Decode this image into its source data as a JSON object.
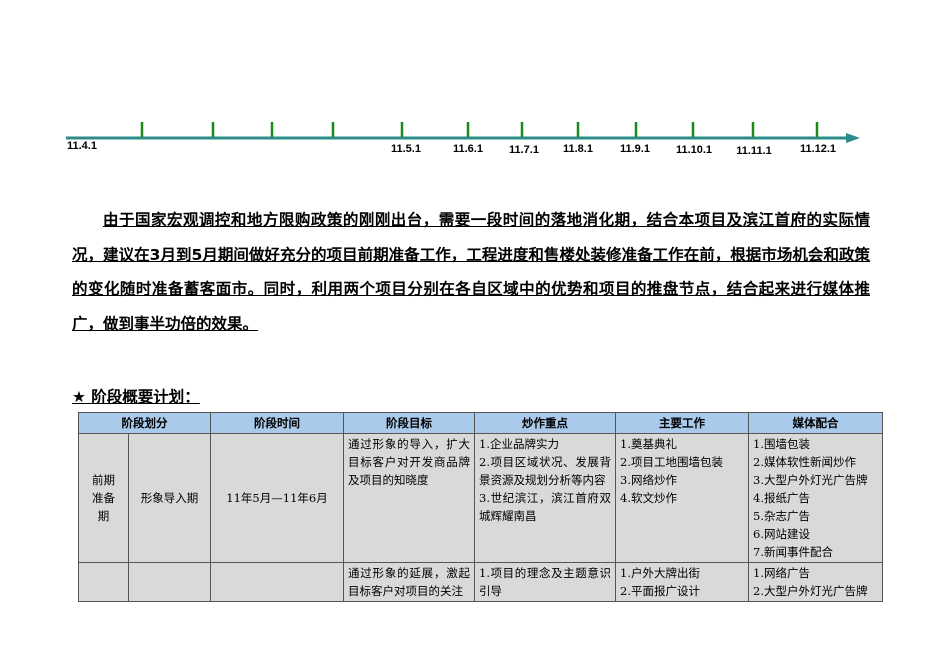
{
  "timeline": {
    "labels": [
      {
        "text": "11.4.1"
      },
      {
        "text": "11.5.1"
      },
      {
        "text": "11.6.1"
      },
      {
        "text": "11.7.1"
      },
      {
        "text": "11.8.1"
      },
      {
        "text": "11.9.1"
      },
      {
        "text": "11.10.1"
      },
      {
        "text": "11.11.1"
      },
      {
        "text": "11.12.1"
      }
    ],
    "color": "#2e8b8b",
    "tick_color": "#1a8a1a"
  },
  "paragraph": "由于国家宏观调控和地方限购政策的刚刚出台，需要一段时间的落地消化期，结合本项目及滨江首府的实际情况，建议在3月到5月期间做好充分的项目前期准备工作，工程进度和售楼处装修准备工作在前，根据市场机会和政策的变化随时准备蓄客面市。同时，利用两个项目分别在各自区域中的优势和项目的推盘节点，结合起来进行媒体推广，做到事半功倍的效果。",
  "plan_title": "★ 阶段概要计划：",
  "table": {
    "headers": [
      "阶段划分",
      "阶段时间",
      "阶段目标",
      "炒作重点",
      "主要工作",
      "媒体配合"
    ],
    "rows": [
      {
        "phase": "前期准备期",
        "subphase": "形象导入期",
        "time": "11年5月—11年6月",
        "goal": "通过形象的导入，扩大目标客户对开发商品牌及项目的知晓度",
        "focus": [
          "1.企业品牌实力",
          "2.项目区域状况、发展背景资源及规划分析等内容",
          "3.世纪滨江，滨江首府双城辉耀南昌"
        ],
        "work": [
          "1.奠基典礼",
          "2.项目工地围墙包装",
          "3.网络炒作",
          "4.软文炒作"
        ],
        "media": [
          "1.围墙包装",
          "2.媒体软性新闻炒作",
          "3.大型户外灯光广告牌",
          "4.报纸广告",
          "5.杂志广告",
          "6.网站建设",
          "7.新闻事件配合"
        ]
      },
      {
        "phase": "",
        "subphase": "",
        "time": "",
        "goal": "通过形象的延展，激起目标客户对项目的关注",
        "focus": [
          "1.项目的理念及主题意识引导"
        ],
        "work": [
          "1.户外大牌出街",
          "2.平面报广设计"
        ],
        "media": [
          "1.网络广告",
          "2.大型户外灯光广告牌"
        ]
      }
    ]
  }
}
